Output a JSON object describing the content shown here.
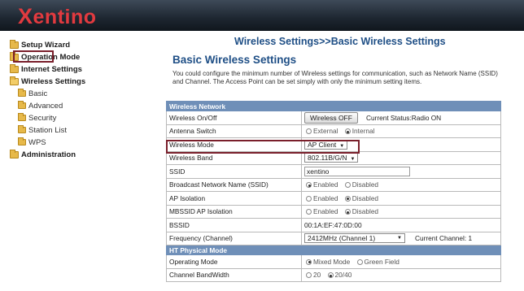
{
  "brand": {
    "logo_x": "X",
    "logo_rest": "entino"
  },
  "sidebar": {
    "items": [
      {
        "label": "Setup Wizard"
      },
      {
        "label": "Operation Mode"
      },
      {
        "label": "Internet Settings"
      },
      {
        "label": "Wireless Settings"
      },
      {
        "label": "Basic"
      },
      {
        "label": "Advanced"
      },
      {
        "label": "Security"
      },
      {
        "label": "Station List"
      },
      {
        "label": "WPS"
      },
      {
        "label": "Administration"
      }
    ]
  },
  "page": {
    "title": "Wireless Settings>>Basic Wireless Settings",
    "heading": "Basic Wireless Settings",
    "description": "You could configure the minimum number of Wireless settings for communication, such as Network Name (SSID) and Channel. The Access Point can be set simply with only the minimum setting items."
  },
  "table": {
    "section_wireless": "Wireless Network",
    "onoff_label": "Wireless On/Off",
    "onoff_button": "Wireless OFF",
    "onoff_status": "Current Status:Radio ON",
    "antenna_label": "Antenna Switch",
    "antenna_opt1": "External",
    "antenna_opt2": "Internal",
    "mode_label": "Wireless Mode",
    "mode_value": "AP Client",
    "band_label": "Wireless Band",
    "band_value": "802.11B/G/N",
    "ssid_label": "SSID",
    "ssid_value": "xentino",
    "broadcast_label": "Broadcast Network Name (SSID)",
    "broadcast_opt1": "Enabled",
    "broadcast_opt2": "Disabled",
    "apiso_label": "AP Isolation",
    "apiso_opt1": "Enabled",
    "apiso_opt2": "Disabled",
    "mbssid_label": "MBSSID AP Isolation",
    "mbssid_opt1": "Enabled",
    "mbssid_opt2": "Disabled",
    "bssid_label": "BSSID",
    "bssid_value": "00:1A:EF:47:0D:00",
    "freq_label": "Frequency (Channel)",
    "freq_value": "2412MHz (Channel 1)",
    "freq_current": "Current Channel: 1",
    "section_ht": "HT Physical Mode",
    "opmode_label": "Operating Mode",
    "opmode_opt1": "Mixed Mode",
    "opmode_opt2": "Green Field",
    "bw_label": "Channel BandWidth",
    "bw_opt1": "20",
    "bw_opt2": "20/40"
  },
  "colors": {
    "accent": "#1f4f86",
    "section": "#6f8fb8",
    "highlight": "#7a1f2b",
    "logo": "#e23a3f"
  }
}
